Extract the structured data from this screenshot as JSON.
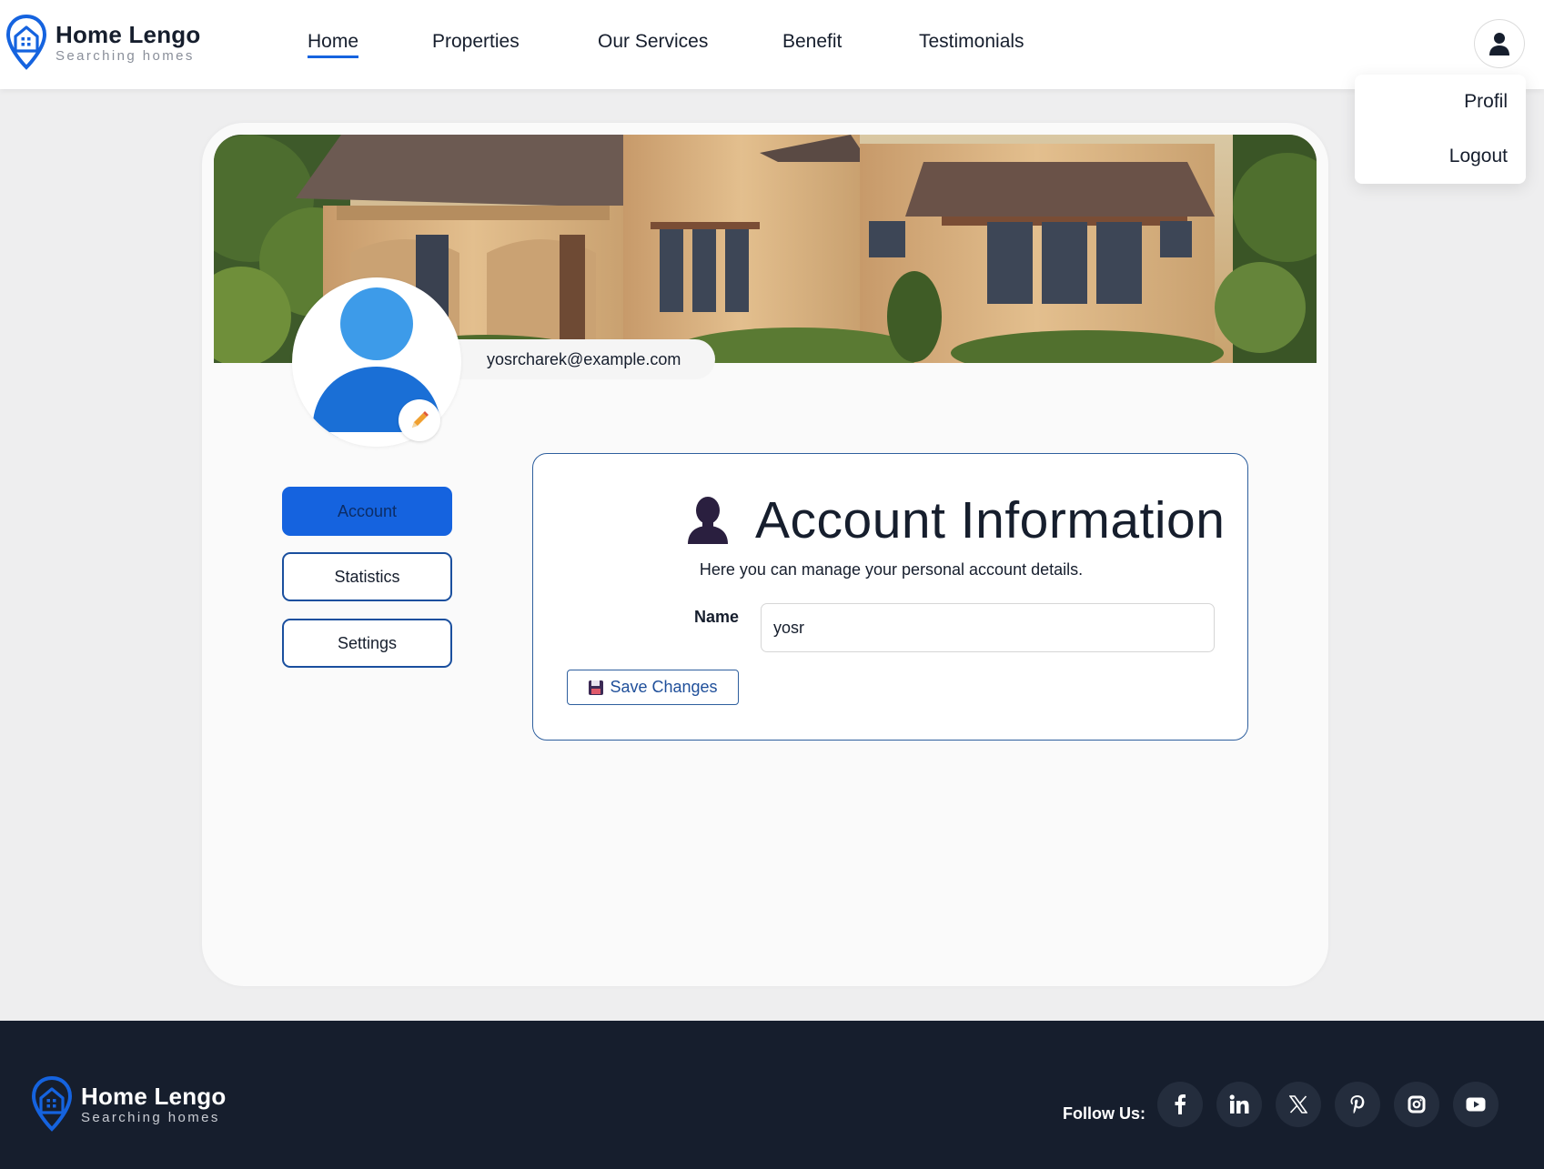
{
  "brand": {
    "name": "Home Lengo",
    "tagline": "Searching homes",
    "accent": "#1563df"
  },
  "nav": {
    "items": [
      "Home",
      "Properties",
      "Our Services",
      "Benefit",
      "Testimonials"
    ],
    "active": "Home"
  },
  "user_menu": {
    "icon": "user-icon",
    "items": [
      "Profil",
      "Logout"
    ]
  },
  "profile": {
    "email": "yosrcharek@example.com",
    "edit_icon": "pencil-icon"
  },
  "sidebar": {
    "items": [
      {
        "label": "Account",
        "active": true
      },
      {
        "label": "Statistics",
        "active": false
      },
      {
        "label": "Settings",
        "active": false
      }
    ]
  },
  "account": {
    "title": "Account Information",
    "subtitle": "Here you can manage your personal account details.",
    "name_label": "Name",
    "name_value": "yosr",
    "save_label": "Save Changes",
    "save_icon": "floppy-disk-icon"
  },
  "footer": {
    "follow_label": "Follow Us:",
    "social": [
      "facebook-icon",
      "linkedin-icon",
      "x-icon",
      "pinterest-icon",
      "instagram-icon",
      "youtube-icon"
    ]
  }
}
